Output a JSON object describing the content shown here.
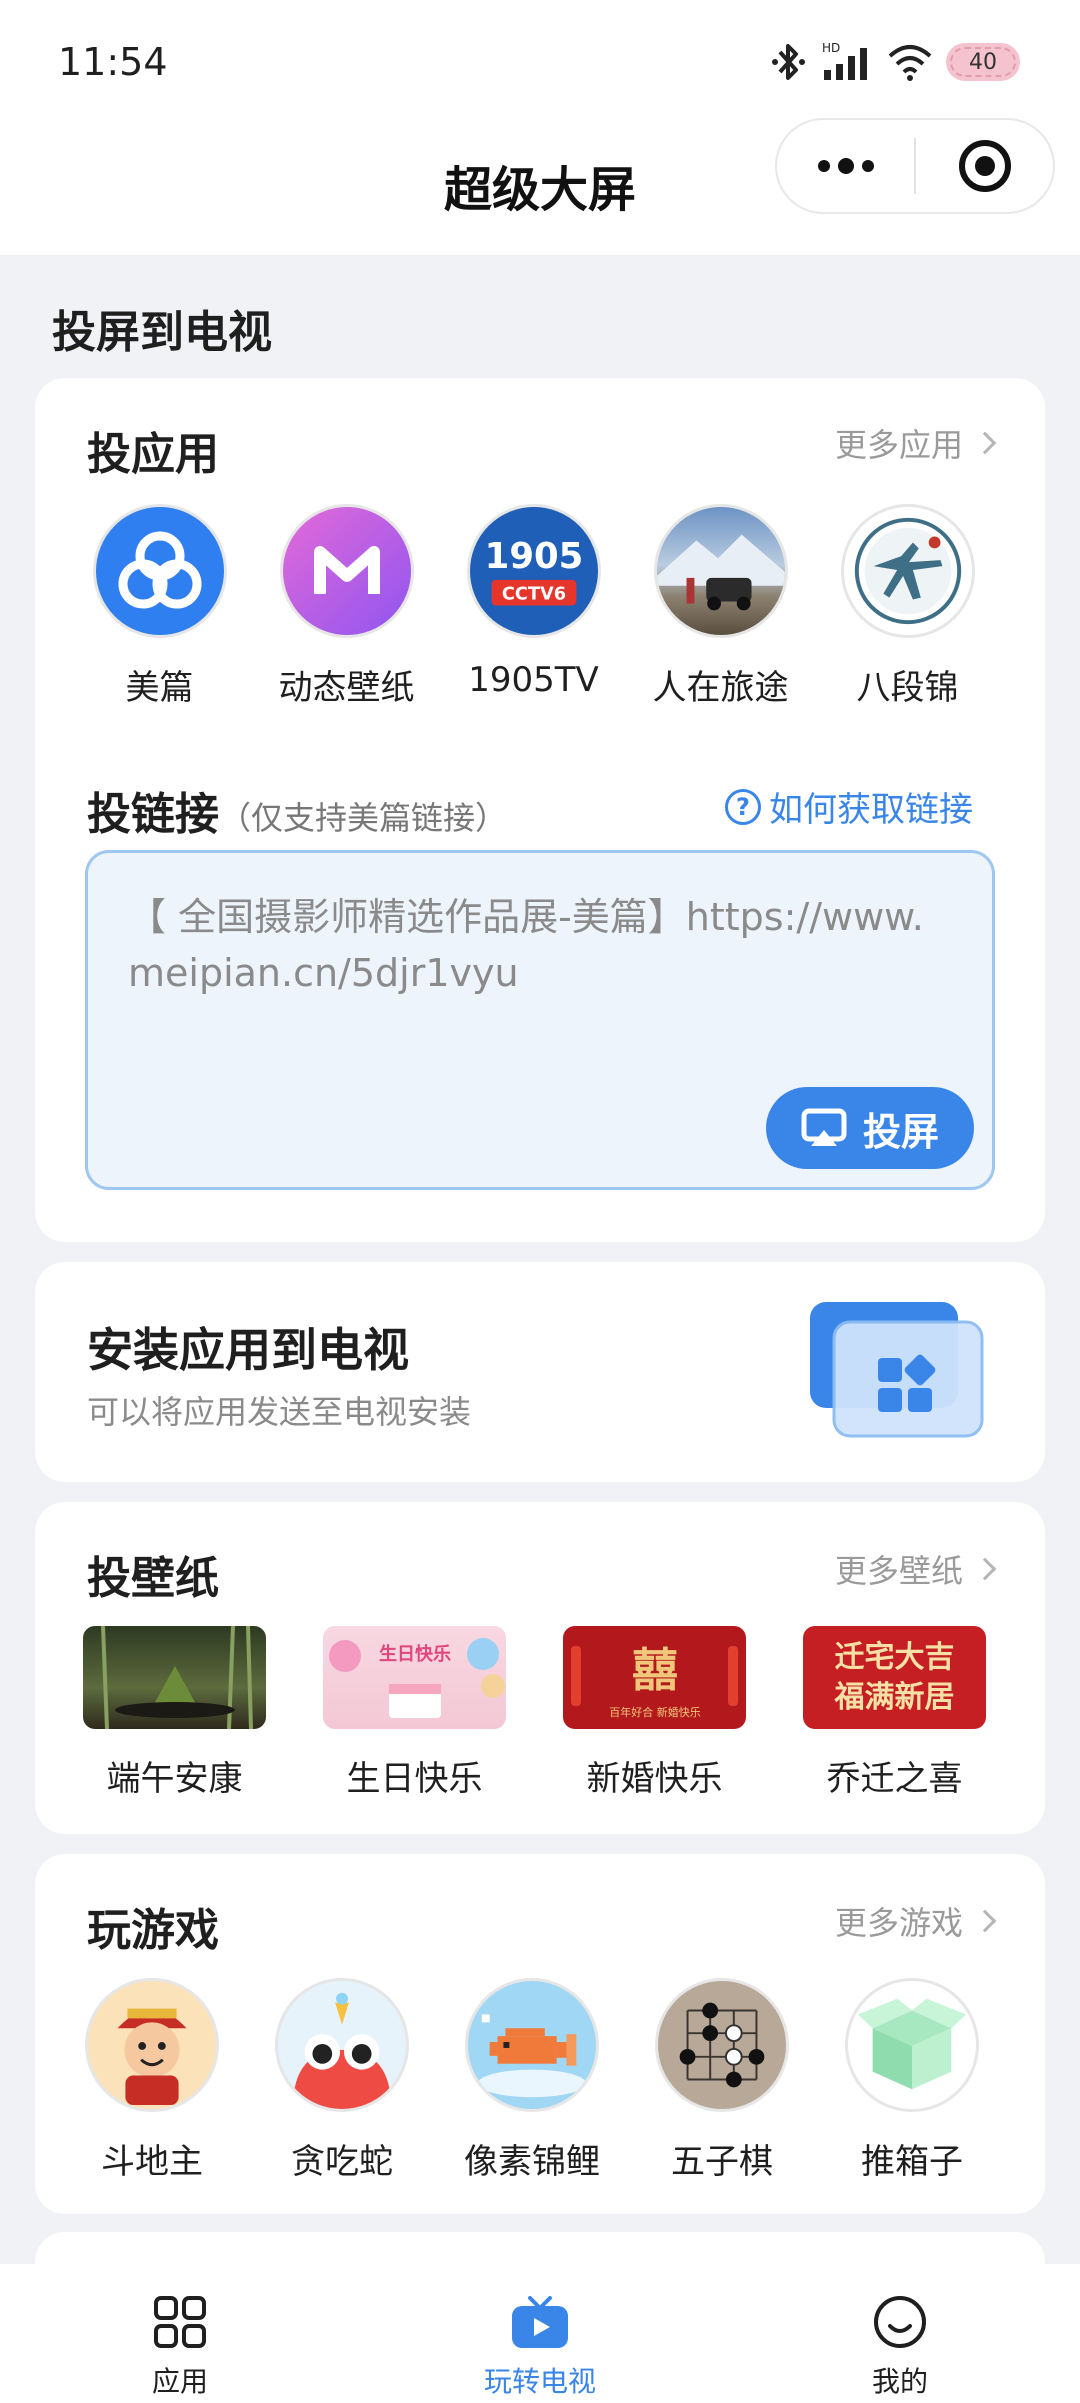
{
  "status": {
    "time": "11:54",
    "battery": "40",
    "network": "HD"
  },
  "nav": {
    "title": "超级大屏"
  },
  "section": {
    "title": "投屏到电视"
  },
  "cast_apps": {
    "title": "投应用",
    "more": "更多应用",
    "items": [
      {
        "label": "美篇",
        "icon": "meipian-icon"
      },
      {
        "label": "动态壁纸",
        "icon": "live-wallpaper-icon"
      },
      {
        "label": "1905TV",
        "icon": "1905tv-icon",
        "logo_text": "1905",
        "logo_sub": "CCTV6"
      },
      {
        "label": "人在旅途",
        "icon": "travel-icon"
      },
      {
        "label": "八段锦",
        "icon": "baduanjin-icon"
      }
    ]
  },
  "cast_link": {
    "title": "投链接",
    "subtitle": "（仅支持美篇链接）",
    "help": "如何获取链接",
    "text": "【 全国摄影师精选作品展-美篇】https://www.meipian.cn/5djr1vyu",
    "button": "投屏"
  },
  "install": {
    "title": "安装应用到电视",
    "desc": "可以将应用发送至电视安装"
  },
  "wallpapers": {
    "title": "投壁纸",
    "more": "更多壁纸",
    "items": [
      {
        "label": "端午安康"
      },
      {
        "label": "生日快乐",
        "thumb_text": "生日快乐"
      },
      {
        "label": "新婚快乐",
        "thumb_text": "囍",
        "thumb_sub": "百年好合 新婚快乐"
      },
      {
        "label": "乔迁之喜",
        "thumb_text": "迁宅大吉 福满新居"
      }
    ]
  },
  "games": {
    "title": "玩游戏",
    "more": "更多游戏",
    "items": [
      {
        "label": "斗地主",
        "icon": "doudizhu-icon"
      },
      {
        "label": "贪吃蛇",
        "icon": "snake-icon"
      },
      {
        "label": "像素锦鲤",
        "icon": "pixel-koi-icon"
      },
      {
        "label": "五子棋",
        "icon": "gomoku-icon"
      },
      {
        "label": "推箱子",
        "icon": "sokoban-icon"
      }
    ]
  },
  "tabs": [
    {
      "label": "应用",
      "icon": "apps-grid-icon"
    },
    {
      "label": "玩转电视",
      "icon": "tv-play-icon"
    },
    {
      "label": "我的",
      "icon": "smiley-face-icon"
    }
  ],
  "colors": {
    "accent": "#3a86e8",
    "background": "#f0f2f5"
  }
}
